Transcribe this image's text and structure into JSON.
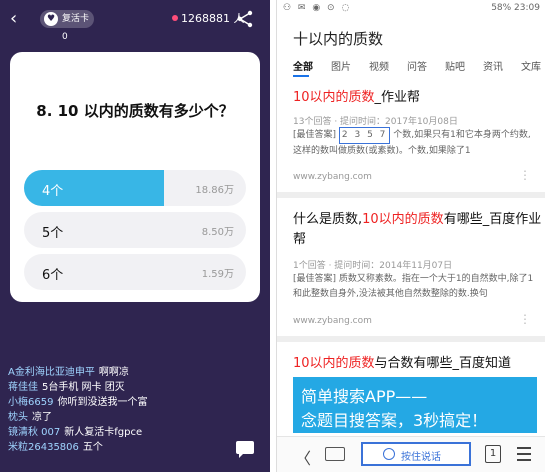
{
  "left": {
    "revive_card": "复活卡 0",
    "viewer_count": "1268881 人",
    "question": "8. 10 以内的质数有多少个？",
    "options": [
      {
        "label": "4个",
        "count": "18.86万",
        "share": 0.63,
        "selected": true
      },
      {
        "label": "5个",
        "count": "8.50万",
        "share": 0.28,
        "selected": false
      },
      {
        "label": "6个",
        "count": "1.59万",
        "share": 0.05,
        "selected": false
      }
    ],
    "chat": [
      {
        "user": "",
        "text": "",
        "faded": true
      },
      {
        "user": "A金利海比亚迪申平",
        "text": "啊啊凉",
        "faded": false
      },
      {
        "user": "蒋佳佳",
        "text": "5台手机 网卡 团灭",
        "faded": false
      },
      {
        "user": "小梅6659",
        "text": "你听到没送我一个富",
        "faded": false
      },
      {
        "user": "枕头",
        "text": "凉了",
        "faded": false
      },
      {
        "user": "镜清秋 007",
        "text": "新人复活卡fgpce",
        "faded": false
      },
      {
        "user": "米粒26435806",
        "text": "五个",
        "faded": false
      }
    ],
    "colors": {
      "bg": "#2f2550",
      "accent": "#38b6e6"
    }
  },
  "right": {
    "status": {
      "left": "⚇ ✉ ◉ ⊙ ◌",
      "right": "58% 23:09"
    },
    "search_title": "十以内的质数",
    "tabs": [
      "全部",
      "图片",
      "视频",
      "问答",
      "贴吧",
      "资讯",
      "文库"
    ],
    "results": [
      {
        "title_hl": "10以内的质数",
        "title_rest": "_作业帮",
        "meta": "13个回答 · 提问时间：2017年10月08日",
        "snippet_label": "[最佳答案]",
        "primes": "2 3 5 7",
        "snippet_rest": "个数,如果只有1和它本身两个约数,这样的数叫做质数(或素数)。个数,如果除了1",
        "url": "www.zybang.com"
      },
      {
        "title_pre": "什么是质数,",
        "title_hl": "10以内的质数",
        "title_rest": "有哪些_百度作业帮",
        "meta": "1个回答 · 提问时间：2014年11月07日",
        "snippet": "[最佳答案] 质数又称素数。指在一个大于1的自然数中,除了1和此整数自身外,没法被其他自然数整除的数.换句",
        "url": "www.zybang.com"
      },
      {
        "title_hl": "10以内的质数",
        "title_rest": "与合数有哪些_百度知道"
      }
    ],
    "promo": {
      "line1": "简单搜索APP——",
      "line2": "念题目搜答案，3秒搞定！"
    },
    "bottom": {
      "back": "〈",
      "voice": "按住说话",
      "tab_count": "1"
    }
  }
}
